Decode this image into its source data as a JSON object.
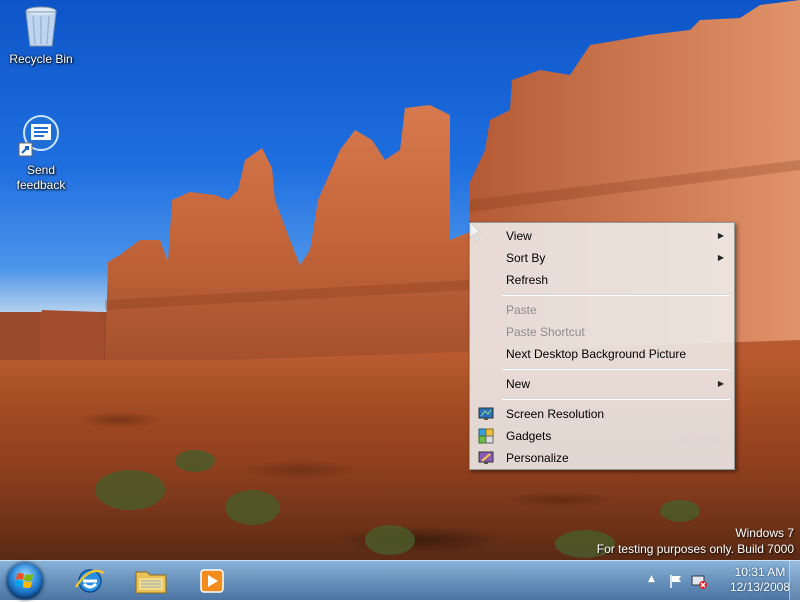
{
  "desktop": {
    "icons": [
      {
        "label": "Recycle Bin",
        "icon": "recycle-bin-icon"
      },
      {
        "label": "Send\nfeedback",
        "label_line1": "Send",
        "label_line2": "feedback",
        "icon": "feedback-icon"
      }
    ],
    "watermark": {
      "line1": "Windows 7",
      "line2": "For testing purposes only. Build 7000"
    }
  },
  "context_menu": {
    "items": [
      {
        "label": "View",
        "submenu": true,
        "enabled": true
      },
      {
        "label": "Sort By",
        "submenu": true,
        "enabled": true
      },
      {
        "label": "Refresh",
        "submenu": false,
        "enabled": true
      },
      {
        "label": "Paste",
        "submenu": false,
        "enabled": false
      },
      {
        "label": "Paste Shortcut",
        "submenu": false,
        "enabled": false
      },
      {
        "label": "Next Desktop Background Picture",
        "submenu": false,
        "enabled": true
      },
      {
        "label": "New",
        "submenu": true,
        "enabled": true
      },
      {
        "label": "Screen Resolution",
        "icon": "screen-resolution-icon",
        "enabled": true
      },
      {
        "label": "Gadgets",
        "icon": "gadgets-icon",
        "enabled": true
      },
      {
        "label": "Personalize",
        "icon": "personalize-icon",
        "enabled": true
      }
    ],
    "submenu_arrow": "▶"
  },
  "taskbar": {
    "pinned": [
      {
        "name": "internet-explorer",
        "icon": "internet-explorer-icon"
      },
      {
        "name": "windows-explorer",
        "icon": "folder-icon"
      },
      {
        "name": "media-player",
        "icon": "media-player-icon"
      }
    ],
    "tray": {
      "show_hidden": "▲",
      "time": "10:31 AM",
      "date": "12/13/2008"
    }
  },
  "colors": {
    "taskbar": "#6d98c6",
    "menu_background": "#f0f0f0",
    "disabled_text": "#8d8d8d"
  }
}
